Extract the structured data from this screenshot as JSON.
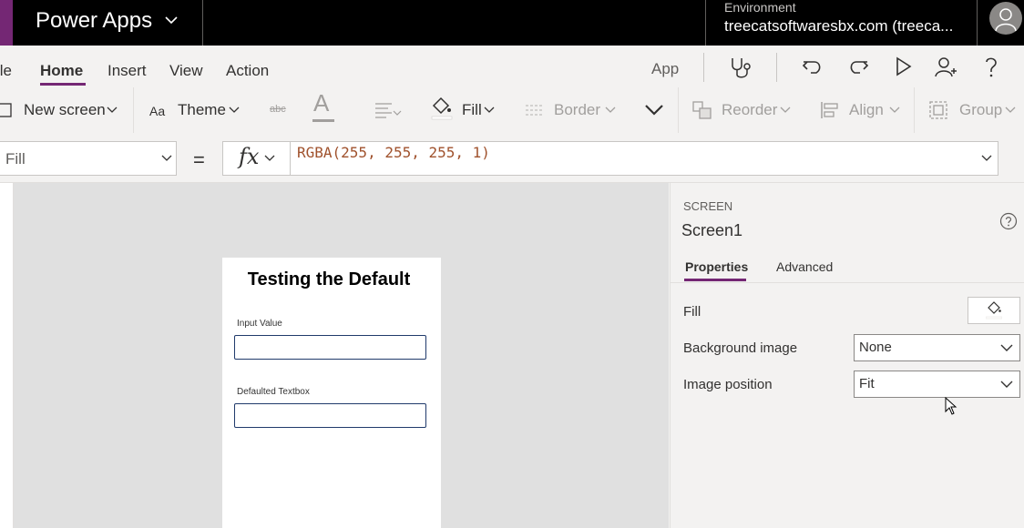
{
  "header": {
    "app_title": "Power Apps",
    "environment_label": "Environment",
    "environment_value": "treecatsoftwaresbx.com (treeca..."
  },
  "menu": {
    "tabs": [
      "ile",
      "Home",
      "Insert",
      "View",
      "Action"
    ],
    "active_tab": "Home",
    "app_label": "App"
  },
  "ribbon": {
    "new_screen": "New screen",
    "theme": "Theme",
    "fill": "Fill",
    "border": "Border",
    "reorder": "Reorder",
    "align": "Align",
    "group": "Group",
    "strike_sample": "abc"
  },
  "formula_bar": {
    "property": "Fill",
    "equals": "=",
    "fx": "fx",
    "formula": "RGBA(255, 255, 255, 1)"
  },
  "canvas": {
    "title": "Testing the Default",
    "input_label": "Input Value",
    "defaulted_label": "Defaulted Textbox"
  },
  "panel": {
    "kind": "SCREEN",
    "name": "Screen1",
    "tabs": [
      "Properties",
      "Advanced"
    ],
    "props": {
      "fill_label": "Fill",
      "bg_image_label": "Background image",
      "bg_image_value": "None",
      "image_pos_label": "Image position",
      "image_pos_value": "Fit"
    }
  },
  "colors": {
    "accent": "#742774",
    "topbar": "#000000",
    "input_border": "#203a6b"
  }
}
